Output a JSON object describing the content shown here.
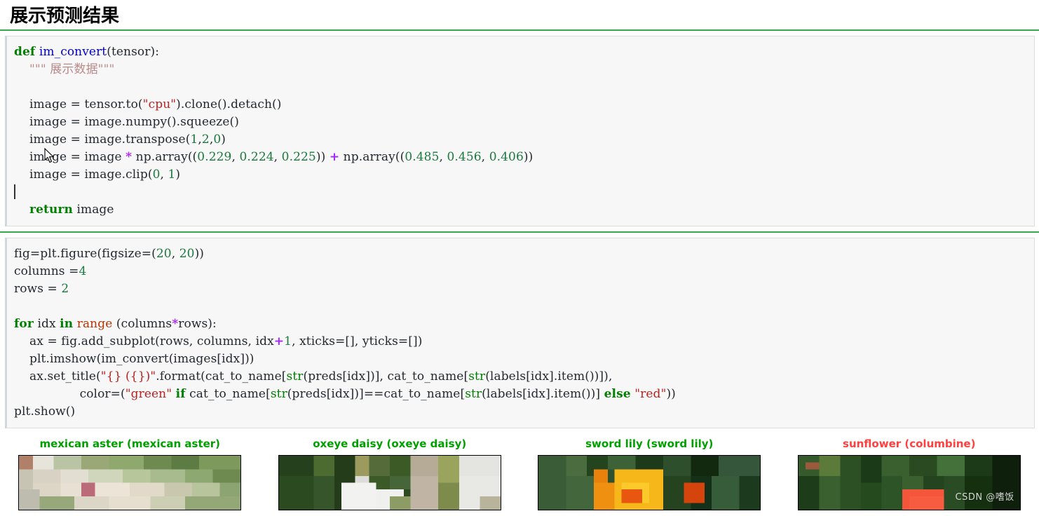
{
  "heading": "展示预测结果",
  "colors": {
    "cell_separator_green": "#3aa84a",
    "title_match_green": "#00a000",
    "title_mismatch_red": "#ff4040",
    "code_bg": "#f7f7f7",
    "keyword": "#008000",
    "string": "#ba2121",
    "number": "#1a7a3c",
    "operator": "#aa22ff",
    "function_name": "#0000cf"
  },
  "cells": [
    {
      "name": "code-cell-im-convert",
      "lines": [
        "def im_convert(tensor):",
        "    \"\"\" 展示数据\"\"\"",
        "",
        "    image = tensor.to(\"cpu\").clone().detach()",
        "    image = image.numpy().squeeze()",
        "    image = image.transpose(1,2,0)",
        "    image = image * np.array((0.229, 0.224, 0.225)) + np.array((0.485, 0.456, 0.406))",
        "    image = image.clip(0, 1)",
        "",
        "    return image"
      ]
    },
    {
      "name": "code-cell-plot-predictions",
      "lines": [
        "fig=plt.figure(figsize=(20, 20))",
        "columns =4",
        "rows = 2",
        "",
        "for idx in range (columns*rows):",
        "    ax = fig.add_subplot(rows, columns, idx+1, xticks=[], yticks=[])",
        "    plt.imshow(im_convert(images[idx]))",
        "    ax.set_title(\"{} ({})\".format(cat_to_name[str(preds[idx])], cat_to_name[str(labels[idx].item())]),",
        "                 color=(\"green\" if cat_to_name[str(preds[idx])]==cat_to_name[str(labels[idx].item())] else \"red\"))",
        "plt.show()"
      ]
    }
  ],
  "output": {
    "name": "prediction-figure",
    "subplots": [
      {
        "title": "mexican aster (mexican aster)",
        "predicted": "mexican aster",
        "actual": "mexican aster",
        "correct": true,
        "color": "#00a000"
      },
      {
        "title": "oxeye daisy (oxeye daisy)",
        "predicted": "oxeye daisy",
        "actual": "oxeye daisy",
        "correct": true,
        "color": "#00a000"
      },
      {
        "title": "sword lily (sword lily)",
        "predicted": "sword lily",
        "actual": "sword lily",
        "correct": true,
        "color": "#00a000"
      },
      {
        "title": "sunflower (columbine)",
        "predicted": "sunflower",
        "actual": "columbine",
        "correct": false,
        "color": "#ff4040"
      }
    ]
  },
  "watermark": "CSDN @嗜饭"
}
